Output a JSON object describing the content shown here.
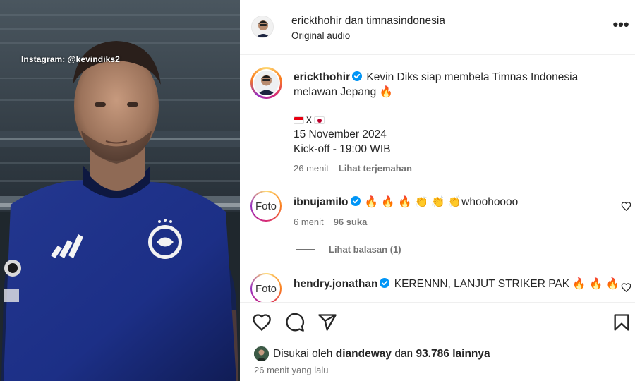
{
  "media": {
    "watermark": "Instagram: @kevindiks2"
  },
  "header": {
    "title": "erickthohir dan timnasindonesia",
    "subtitle": "Original audio",
    "more_label": "•••"
  },
  "caption": {
    "username": "erickthohir",
    "text_line": "Kevin Diks siap membela Timnas Indonesia melawan Jepang 🔥",
    "flags_sep": "x",
    "date": "15 November 2024",
    "kickoff": "Kick-off - 19:00 WIB",
    "time": "26 menit",
    "translate": "Lihat terjemahan"
  },
  "comments": [
    {
      "avatar_text": "Foto",
      "username": "ibnujamilo",
      "text": "🔥 🔥 🔥 👏 👏 👏whoohoooo",
      "time": "6 menit",
      "likes": "96 suka"
    },
    {
      "avatar_text": "Foto",
      "username": "hendry.jonathan",
      "text": "KERENNN, LANJUT STRIKER PAK 🔥 🔥 🔥"
    }
  ],
  "replies_label": "Lihat balasan (1)",
  "footer": {
    "liked_prefix": "Disukai oleh",
    "liked_user": "diandeway",
    "liked_conj": "dan",
    "liked_count": "93.786 lainnya",
    "posted": "26 menit yang lalu"
  },
  "icons": {
    "like": "heart-icon",
    "comment": "comment-icon",
    "share": "share-icon",
    "save": "bookmark-icon",
    "verified": "verified-badge-icon"
  },
  "colors": {
    "verified": "#0095f6",
    "jersey": "#1c2f86",
    "secondary_text": "#737373"
  }
}
